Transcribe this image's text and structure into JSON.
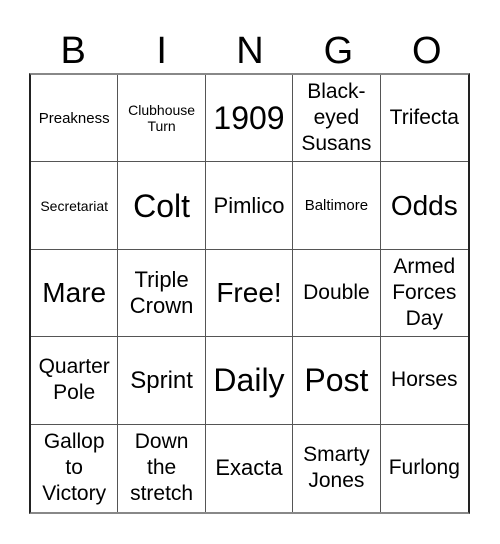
{
  "header": [
    "B",
    "I",
    "N",
    "G",
    "O"
  ],
  "cells": [
    "Preakness",
    "Clubhouse Turn",
    "1909",
    "Black-eyed Susans",
    "Trifecta",
    "Secretariat",
    "Colt",
    "Pimlico",
    "Baltimore",
    "Odds",
    "Mare",
    "Triple Crown",
    "Free!",
    "Double",
    "Armed Forces Day",
    "Quarter Pole",
    "Sprint",
    "Daily",
    "Post",
    "Horses",
    "Gallop to Victory",
    "Down the stretch",
    "Exacta",
    "Smarty Jones",
    "Furlong"
  ],
  "cell_lines": [
    [
      "Preakness"
    ],
    [
      "Clubhouse",
      "Turn"
    ],
    [
      "1909"
    ],
    [
      "Black-",
      "eyed",
      "Susans"
    ],
    [
      "Trifecta"
    ],
    [
      "Secretariat"
    ],
    [
      "Colt"
    ],
    [
      "Pimlico"
    ],
    [
      "Baltimore"
    ],
    [
      "Odds"
    ],
    [
      "Mare"
    ],
    [
      "Triple",
      "Crown"
    ],
    [
      "Free!"
    ],
    [
      "Double"
    ],
    [
      "Armed",
      "Forces",
      "Day"
    ],
    [
      "Quarter",
      "Pole"
    ],
    [
      "Sprint"
    ],
    [
      "Daily"
    ],
    [
      "Post"
    ],
    [
      "Horses"
    ],
    [
      "Gallop",
      "to",
      "Victory"
    ],
    [
      "Down",
      "the",
      "stretch"
    ],
    [
      "Exacta"
    ],
    [
      "Smarty",
      "Jones"
    ],
    [
      "Furlong"
    ]
  ]
}
